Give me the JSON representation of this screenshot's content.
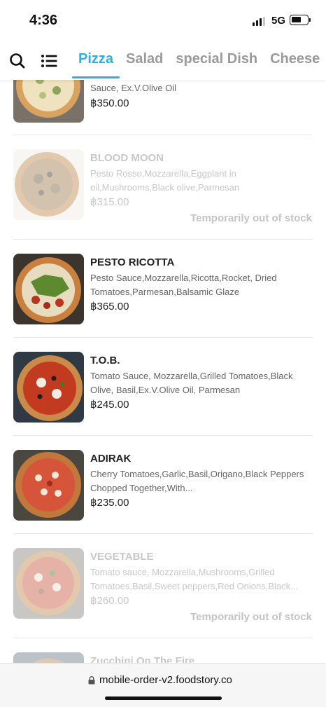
{
  "status": {
    "time": "4:36",
    "network": "5G"
  },
  "nav": {
    "tabs": [
      {
        "label": "Pizza",
        "active": true
      },
      {
        "label": "Salad"
      },
      {
        "label": "special Dish"
      },
      {
        "label": "Cheese"
      }
    ],
    "accent_color": "#31aee0"
  },
  "items": [
    {
      "name": "",
      "desc": "Sauce, Ex.V.Olive Oil",
      "price": "฿350.00",
      "available": true
    },
    {
      "name": "BLOOD MOON",
      "desc": "Pesto Rosso,Mozzarella,Eggplant in oil,Mushrooms,Black olive,Parmesan",
      "price": "฿315.00",
      "available": false,
      "stock_label": "Temporarily out of stock"
    },
    {
      "name": "PESTO RICOTTA",
      "desc": "Pesto Sauce,Mozzarella,Ricotta,Rocket, Dried Tomatoes,Parmesan,Balsamic Glaze",
      "price": "฿365.00",
      "available": true
    },
    {
      "name": "T.O.B.",
      "desc": "Tomato Sauce, Mozzarella,Grilled Tomatoes,Black Olive, Basil,Ex.V.Olive Oil, Parmesan",
      "price": "฿245.00",
      "available": true
    },
    {
      "name": "ADIRAK",
      "desc": "Cherry Tomatoes,Garlic,Basil,Origano,Black Peppers Chopped Together,With...",
      "price": "฿235.00",
      "available": true
    },
    {
      "name": "VEGETABLE",
      "desc": "Tomato sauce, Mozzarella,Mushrooms,Grilled Tomatoes,Basil,Sweet peppers,Red Onions,Black...",
      "price": "฿260.00",
      "available": false,
      "stock_label": "Temporarily out of stock"
    },
    {
      "name": "Zucchini On The Fire",
      "desc": "",
      "price": "",
      "available": false
    }
  ],
  "browser": {
    "url": "mobile-order-v2.foodstory.co"
  }
}
